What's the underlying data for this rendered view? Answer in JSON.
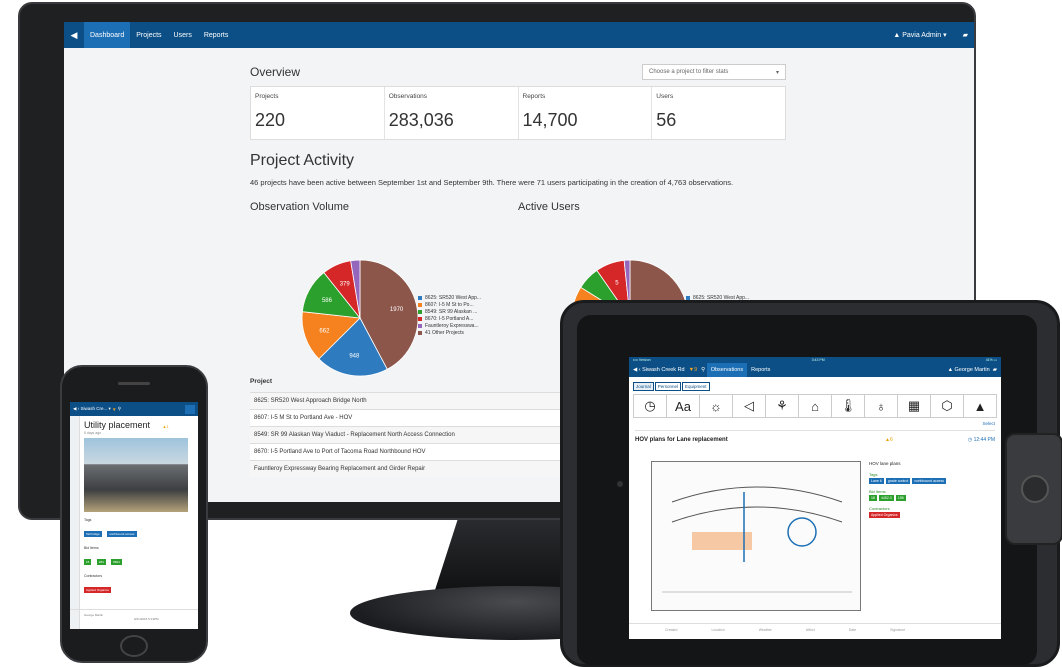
{
  "monitor": {
    "nav": {
      "items": [
        "Dashboard",
        "Projects",
        "Users",
        "Reports"
      ],
      "user": "▲ Pavia Admin ▾"
    },
    "overview": {
      "title": "Overview",
      "filter_placeholder": "Choose a project to filter stats",
      "stats": [
        {
          "label": "Projects",
          "value": "220"
        },
        {
          "label": "Observations",
          "value": "283,036"
        },
        {
          "label": "Reports",
          "value": "14,700"
        },
        {
          "label": "Users",
          "value": "56"
        }
      ]
    },
    "activity": {
      "title": "Project Activity",
      "text": "46 projects have been active between September 1st and September 9th. There were 71 users participating in the creation of 4,763 observations."
    },
    "charts": {
      "volume_title": "Observation Volume",
      "users_title": "Active Users"
    },
    "projects": {
      "header": "Project",
      "rows": [
        "8625: SR520 West Approach Bridge North",
        "8607: I-5 M St to Portland Ave - HOV",
        "8549: SR 99 Alaskan Way Viaduct - Replacement North Access Connection",
        "8670: I-5 Portland Ave to Port of Tacoma Road Northbound HOV",
        "Fauntleroy Expressway Bearing Replacement and Girder Repair"
      ]
    }
  },
  "chart_data": [
    {
      "type": "pie",
      "title": "Observation Volume",
      "categories": [
        "8625: SR520 West App...",
        "8607: I-5 M St to Po...",
        "8549: SR 99 Alaskan ...",
        "8670: I-5 Portland A...",
        "Fauntleroy Expresswa...",
        "41 Other Projects"
      ],
      "values": [
        948,
        662,
        586,
        379,
        120,
        1970
      ],
      "colors": [
        "#2e7bbf",
        "#f5821f",
        "#2ca02c",
        "#d62728",
        "#9467bd",
        "#8c564b"
      ],
      "data_labels": [
        "948",
        "662",
        "586",
        "379",
        "",
        "1970"
      ],
      "legend": "right"
    },
    {
      "type": "pie",
      "title": "Active Users",
      "categories": [
        "8625: SR520 West App...",
        "8607: I-5 M St to Po...",
        "8549: SR 99 Alaskan ...",
        "8670: I-5 Portland A...",
        "Fauntleroy Expresswa...",
        "41 Other Projects"
      ],
      "values": [
        12,
        7,
        4,
        5,
        1,
        33
      ],
      "colors": [
        "#2e7bbf",
        "#f5821f",
        "#2ca02c",
        "#d62728",
        "#9467bd",
        "#8c564b"
      ],
      "data_labels": [
        "12",
        "7",
        "",
        "5",
        "",
        ""
      ],
      "legend": "right"
    }
  ],
  "phone": {
    "nav_title": "Siwash Cre... ▾",
    "card_title": "Utility placement",
    "card_warning": "▲1",
    "card_time": "5 days ago",
    "tags_label": "Tags",
    "tags": [
      "Tall bridge",
      "northbound access"
    ],
    "bid_items_label": "Bid Items",
    "bid_items": [
      "15",
      "284",
      "8821"
    ],
    "contractors_label": "Contractors",
    "contractors": [
      "Applied Organics"
    ],
    "footer_user": "George Martin",
    "footer_date": "9/21/2016 5:13PM"
  },
  "tablet": {
    "status_left": "•••• Verizon",
    "status_center": "3:43 PM",
    "status_right": "41% ▭",
    "back_label": "‹ Siwash Creek Rd",
    "filter_count": "▼9",
    "tabs": [
      "Observations",
      "Reports"
    ],
    "user": "▲ George Martin",
    "subtabs": [
      "Journal",
      "Personnel",
      "Equipment"
    ],
    "tools": [
      "◷",
      "Aa",
      "☼",
      "◁",
      "⚘",
      "⌂",
      "🌡",
      "♁",
      "▦",
      "⬡",
      "▲"
    ],
    "select_label": "Select",
    "obs_title": "HOV plans for Lane replacement",
    "obs_warning": "▲6",
    "obs_time": "◷ 12:44 PM",
    "side_header": "HOV lane plans",
    "tags_label": "Tags",
    "tags": [
      "Lane 6",
      "grade control",
      "northbound access"
    ],
    "bid_items_label": "Bid Items",
    "bid_items": [
      "18",
      "4452.3",
      "156"
    ],
    "contractors_label": "Contractors",
    "contractors": [
      "Applied Organics"
    ],
    "footer_cols": [
      "Created",
      "Location",
      "Weather",
      "Affect",
      "Date",
      "Signature"
    ]
  },
  "colors": {
    "nav": "#0b4f86",
    "nav_active": "#1d6fb5",
    "tag_blue": "#1d6fb5",
    "tag_green": "#2ca02c",
    "tag_red": "#d62728"
  }
}
